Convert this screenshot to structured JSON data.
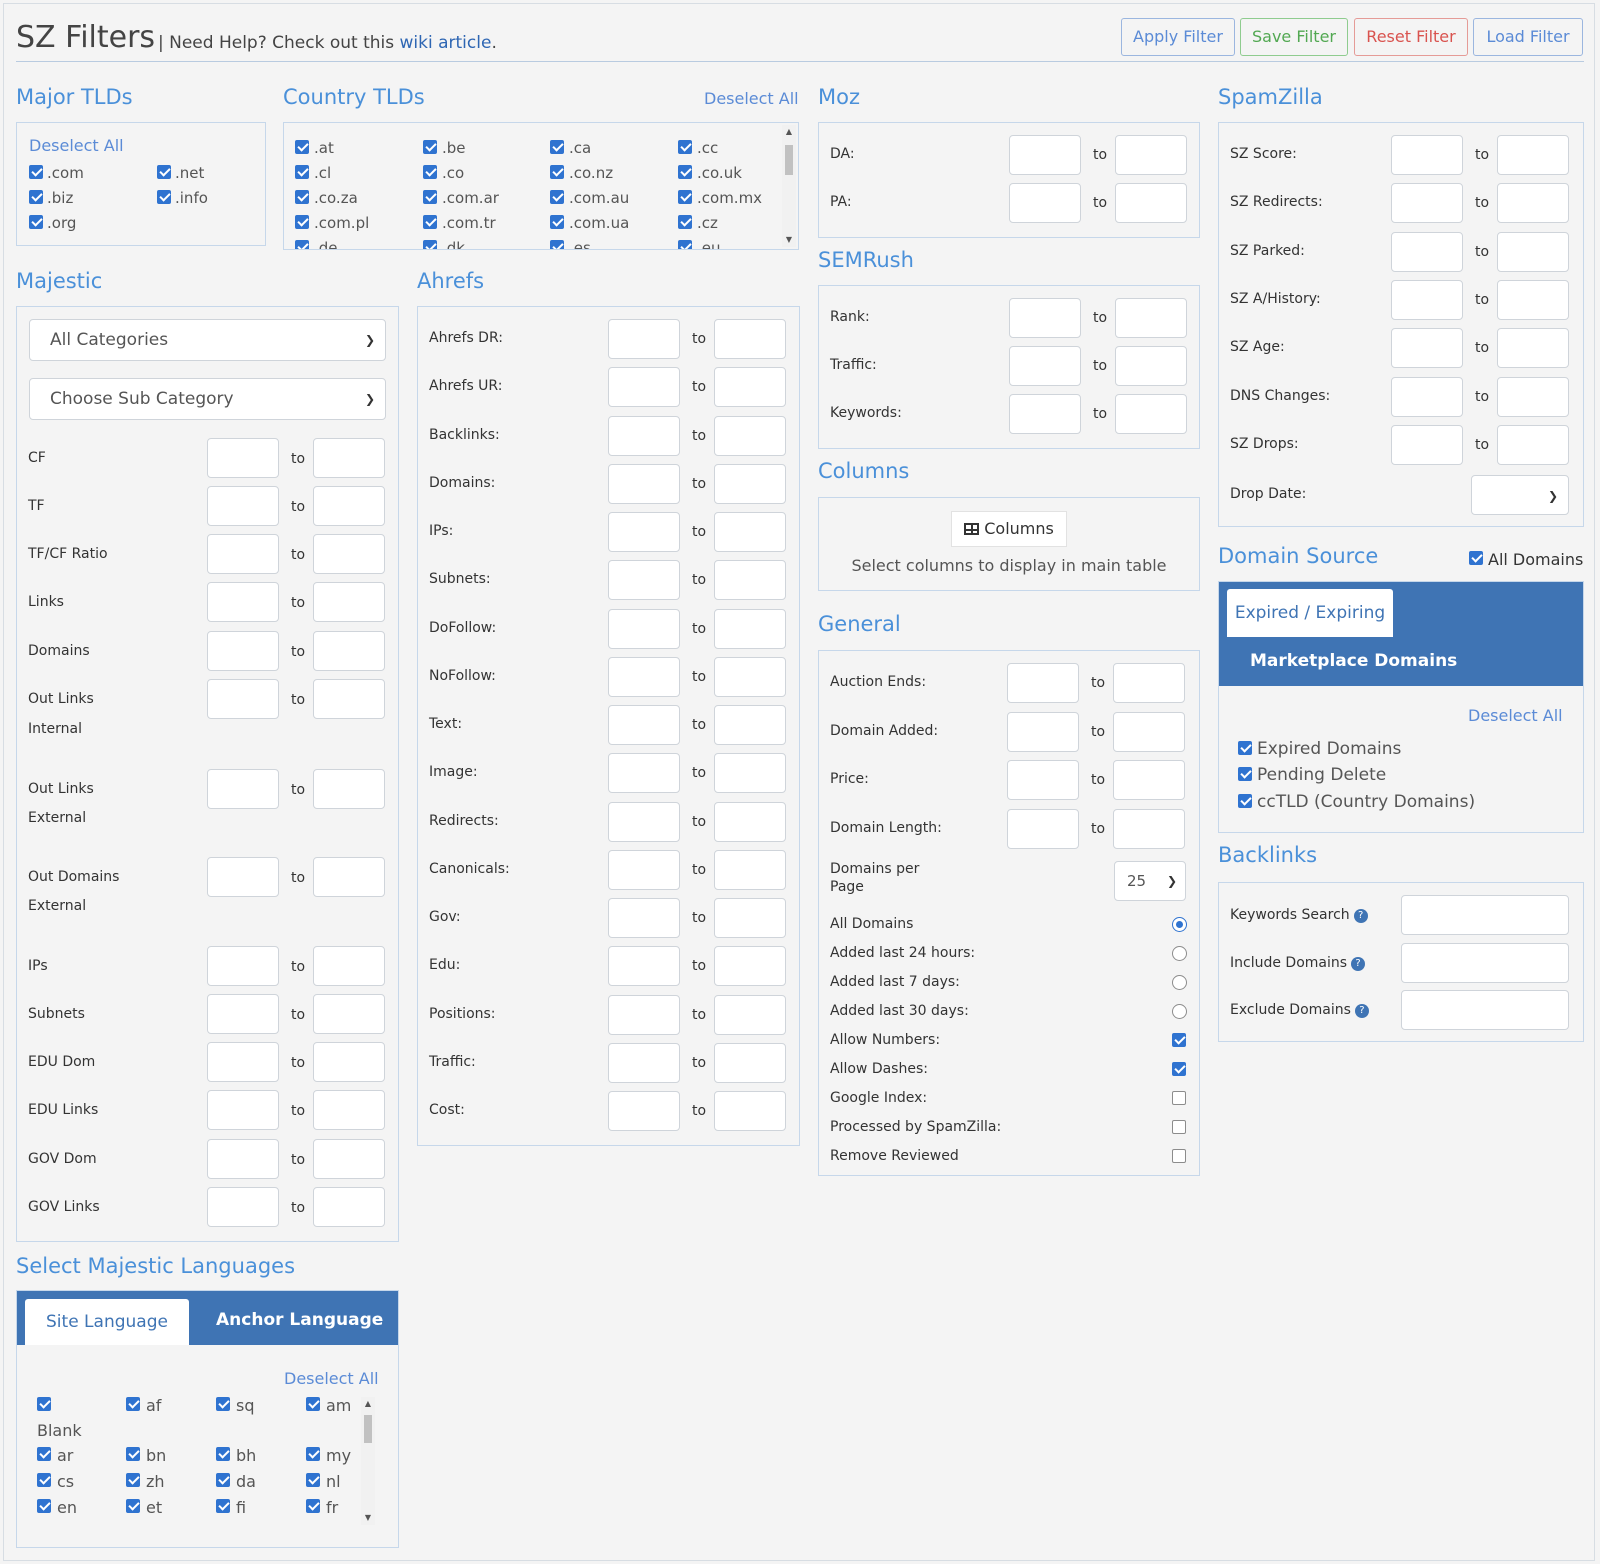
{
  "header": {
    "title": "SZ Filters",
    "help_prefix": "| Need Help? Check out this",
    "help_link": "wiki article",
    "help_suffix": ".",
    "buttons": {
      "apply": "Apply Filter",
      "save": "Save Filter",
      "reset": "Reset Filter",
      "load": "Load Filter"
    }
  },
  "range_to": "to",
  "major_tlds": {
    "title": "Major TLDs",
    "deselect": "Deselect All",
    "items": [
      ".com",
      ".net",
      ".biz",
      ".info",
      ".org"
    ]
  },
  "country_tlds": {
    "title": "Country TLDs",
    "deselect": "Deselect All",
    "items": [
      ".at",
      ".be",
      ".ca",
      ".cc",
      ".cl",
      ".co",
      ".co.nz",
      ".co.uk",
      ".co.za",
      ".com.ar",
      ".com.au",
      ".com.mx",
      ".com.pl",
      ".com.tr",
      ".com.ua",
      ".cz",
      ".de",
      ".dk",
      ".es",
      ".eu"
    ]
  },
  "moz": {
    "title": "Moz",
    "fields": [
      "DA:",
      "PA:"
    ]
  },
  "semrush": {
    "title": "SEMRush",
    "fields": [
      "Rank:",
      "Traffic:",
      "Keywords:"
    ]
  },
  "columns": {
    "title": "Columns",
    "button": "Columns",
    "hint": "Select columns to display in main table"
  },
  "general": {
    "title": "General",
    "fields": [
      "Auction Ends:",
      "Domain Added:",
      "Price:",
      "Domain Length:"
    ],
    "per_page_label_1": "Domains per",
    "per_page_label_2": "Page",
    "per_page_value": "25",
    "radios": [
      "All Domains",
      "Added last 24 hours:",
      "Added last 7 days:",
      "Added last 30 days:"
    ],
    "radio_selected": 0,
    "checks": [
      {
        "label": "Allow Numbers:",
        "checked": true
      },
      {
        "label": "Allow Dashes:",
        "checked": true
      },
      {
        "label": "Google Index:",
        "checked": false
      },
      {
        "label": "Processed by SpamZilla:",
        "checked": false
      },
      {
        "label": "Remove Reviewed",
        "checked": false
      }
    ]
  },
  "spamzilla": {
    "title": "SpamZilla",
    "fields": [
      "SZ Score:",
      "SZ Redirects:",
      "SZ Parked:",
      "SZ A/History:",
      "SZ Age:",
      "DNS Changes:",
      "SZ Drops:"
    ],
    "drop_date_label": "Drop Date:"
  },
  "domain_source": {
    "title": "Domain Source",
    "all_domains": "All Domains",
    "tabs": [
      "Expired / Expiring",
      "Marketplace Domains"
    ],
    "deselect": "Deselect All",
    "items": [
      "Expired Domains",
      "Pending Delete",
      "ccTLD (Country Domains)"
    ]
  },
  "backlinks": {
    "title": "Backlinks",
    "fields": [
      "Keywords Search",
      "Include Domains",
      "Exclude Domains"
    ]
  },
  "majestic": {
    "title": "Majestic",
    "category": "All Categories",
    "sub_category": "Choose Sub Category",
    "fields": [
      "CF",
      "TF",
      "TF/CF Ratio",
      "Links",
      "Domains",
      "Out Links",
      "Internal",
      "Out Links",
      "External",
      "Out Domains",
      "External",
      "IPs",
      "Subnets",
      "EDU Dom",
      "EDU Links",
      "GOV Dom",
      "GOV Links"
    ]
  },
  "ahrefs": {
    "title": "Ahrefs",
    "fields": [
      "Ahrefs DR:",
      "Ahrefs UR:",
      "Backlinks:",
      "Domains:",
      "IPs:",
      "Subnets:",
      "DoFollow:",
      "NoFollow:",
      "Text:",
      "Image:",
      "Redirects:",
      "Canonicals:",
      "Gov:",
      "Edu:",
      "Positions:",
      "Traffic:",
      "Cost:"
    ]
  },
  "languages": {
    "title": "Select Majestic Languages",
    "tabs": [
      "Site Language",
      "Anchor Language"
    ],
    "deselect": "Deselect All",
    "items": [
      "Blank",
      "af",
      "sq",
      "am",
      "ar",
      "bn",
      "bh",
      "my",
      "cs",
      "zh",
      "da",
      "nl",
      "en",
      "et",
      "fi",
      "fr"
    ]
  }
}
